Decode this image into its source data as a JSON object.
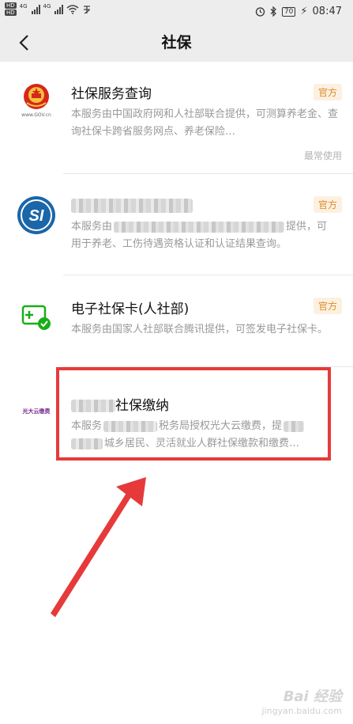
{
  "status_bar": {
    "hd_labels": [
      "HD",
      "HD"
    ],
    "network_labels": [
      "4G",
      "4G"
    ],
    "battery": "70",
    "time": "08:47"
  },
  "nav": {
    "title": "社保"
  },
  "items": [
    {
      "title": "社保服务查询",
      "badge": "官方",
      "desc": "本服务由中国政府网和人社部联合提供，可测算养老金、查询社保卡跨省服务网点、养老保险…",
      "footnote": "最常使用",
      "logo_caption": "www.GOV.cn"
    },
    {
      "badge": "官方",
      "desc_start": "本服务由",
      "desc_end": "提供，可",
      "desc_line2": "用于养老、工伤待遇资格认证和认证结果查询。",
      "logo_text": "SI"
    },
    {
      "title": "电子社保卡(人社部)",
      "badge": "官方",
      "desc": "本服务由国家人社部联合腾讯提供，可签发电子社保卡。"
    },
    {
      "title_suffix": "社保缴纳",
      "desc_start": "本服务",
      "desc_mid": "税务局授权光大云缴费，提",
      "desc_line2_end": "城乡居民、灵活就业人群社保缴款和缴费…",
      "logo_text": "光大云缴费"
    }
  ],
  "watermark": {
    "logo": "Bai 经验",
    "sub": "jingyan.baidu.com"
  },
  "colors": {
    "accent_red": "#e63a3a",
    "badge_orange": "#d88e2b"
  }
}
